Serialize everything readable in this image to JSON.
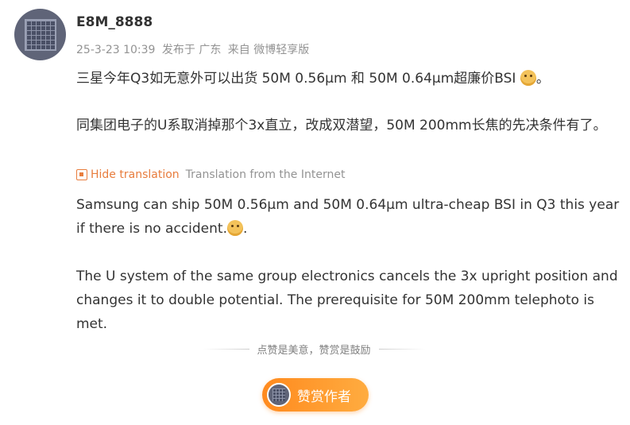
{
  "user": {
    "name": "E8M_8888",
    "avatar_icon": "pixel-grid-avatar-icon"
  },
  "meta": {
    "timestamp": "25-3-23 10:39",
    "published_in": "发布于 广东",
    "source": "来自 微博轻享版"
  },
  "post": {
    "line1": "三星今年Q3如无意外可以出货 50M 0.56μm 和 50M 0.64μm超廉价BSI",
    "line1_end": "。",
    "line2": "同集团电子的U系取消掉那个3x直立，改成双潜望，50M 200mm长焦的先决条件有了。",
    "emoji_icon": "doge-emoji-icon"
  },
  "translation": {
    "hide_label": "Hide translation",
    "source_label": "Translation from the Internet",
    "para1": "Samsung can ship 50M 0.56μm and 50M 0.64μm ultra-cheap BSI in Q3 this year if there is no accident.",
    "para1_end": ".",
    "para2": "The U system of the same group electronics cancels the 3x upright position and changes it to double potential. The prerequisite for 50M 200mm telephoto is met."
  },
  "reward": {
    "divider_text": "点赞是美意，赞赏是鼓励",
    "button_label": "赞赏作者",
    "accent": "#ff8a1e"
  }
}
